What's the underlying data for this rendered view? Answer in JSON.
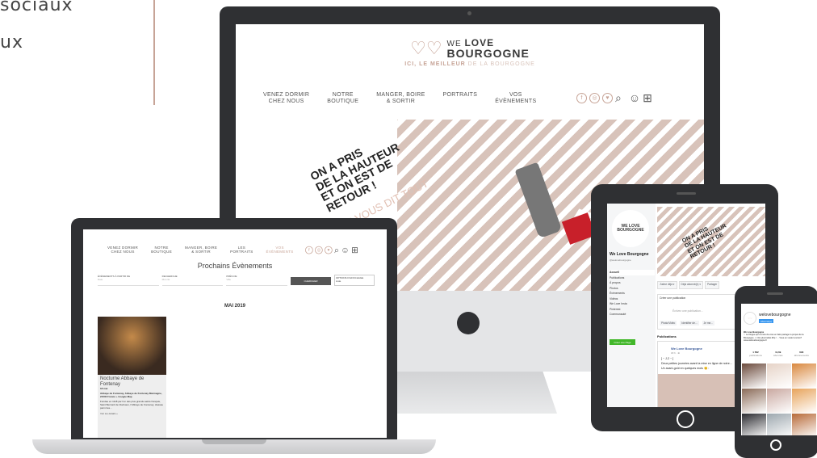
{
  "side_heading": {
    "line1": "sociaux",
    "line2": "ux"
  },
  "brand": {
    "we": "WE",
    "love": "LOVE",
    "bourgogne": "BOURGOGNE",
    "tagline_highlight": "ICI, LE MEILLEUR",
    "tagline_rest": " DE LA BOURGOGNE"
  },
  "desktop_menu": [
    {
      "line1": "VENEZ DORMIR",
      "line2": "CHEZ NOUS"
    },
    {
      "line1": "NOTRE",
      "line2": "BOUTIQUE"
    },
    {
      "line1": "MANGER, BOIRE",
      "line2": "& SORTIR"
    },
    {
      "line1": "PORTRAITS",
      "line2": ""
    },
    {
      "line1": "VOS",
      "line2": "ÉVÈNEMENTS"
    }
  ],
  "laptop_menu": [
    {
      "line1": "VENEZ DORMIR",
      "line2": "CHEZ NOUS"
    },
    {
      "line1": "NOTRE",
      "line2": "BOUTIQUE"
    },
    {
      "line1": "MANGER, BOIRE",
      "line2": "& SORTIR"
    },
    {
      "line1": "LES",
      "line2": "PORTRAITS"
    },
    {
      "line1": "VOS",
      "line2": "ÉVÈNEMENTS"
    }
  ],
  "social_icons": [
    "f",
    "◎",
    "♥"
  ],
  "banner": {
    "line_dark": "ON A PRIS\nDE LA HAUTEUR\nET ON EST DE\nRETOUR !",
    "line_light": "ON VOUS DIT TOUT\nPAR ICI."
  },
  "events_page": {
    "title": "Prochains Évènements",
    "filters": [
      "ÉVÈNEMENTS À PARTIR DE",
      "RECHERCHE",
      "PRÈS DE"
    ],
    "filter_placeholders": [
      "Date",
      "Mot clé",
      "Ville"
    ],
    "search_button": "CHERCHER",
    "options_label": "OPTIONS D'AFFICHAGE",
    "options_value": "Liste",
    "month": "MAI 2019",
    "card": {
      "title": "Nocturne Abbaye de Fontenay",
      "date": "18 mai",
      "address": "Abbaye de Fontenay, Abbaye de Fontenay Marmagne, 21500 France + Google Map",
      "description": "Fondée en 1118 par l'un des plus grands saints français, Saint Bernard de Clairvaux, l'Abbaye de Fontenay, classée parmi les...",
      "more": "Voir les détails »"
    }
  },
  "facebook": {
    "logo_text": "WE LOVE BOURGOGNE",
    "page_name": "We Love Bourgogne",
    "handle": "@welovebourgogne",
    "nav": [
      "Accueil",
      "Publications",
      "À propos",
      "Photos",
      "Évènements",
      "Vidéos",
      "We Love Insta",
      "Pinterest",
      "Communauté"
    ],
    "create_page": "Créer une Page",
    "cover_dark": "ON A PRIS\nDE LA HAUTEUR\nET ON EST DE\nRETOUR !",
    "actions": [
      "J'aime déjà ▾",
      "Déjà abonné(e) ▾",
      "Partager"
    ],
    "create_post": "Créer une publication",
    "write_placeholder": "Écrivez une publication...",
    "post_buttons": [
      "Photo/Vidéo",
      "Identifier de...",
      "Je me..."
    ],
    "publications_label": "Publications",
    "post_author": "We Love Bourgogne",
    "post_date": "18 h · ⊕",
    "post_line1": "[ ~ J-2 ~ ]",
    "post_line2": "Deux petites journées avant la mise en ligne de notre...",
    "post_line3": "Un avant-goût en quelques mots 😊 :"
  },
  "instagram": {
    "username": "welovebourgogne",
    "follow": "Abonné(e)",
    "bio_title": "We Love Bourgogne",
    "bio": "♡ Le blogue qui a envie de vous en faire partager à propos de la Bourgogne. ✦ Vos plus belles #bp ! ... Vous en voulez encore? www.welovebourgogne.fr",
    "stats": [
      {
        "value": "1 562",
        "label": "publications"
      },
      {
        "value": "11,6k",
        "label": "abonnés"
      },
      {
        "value": "693",
        "label": "abonnements"
      }
    ],
    "grid_colors": [
      "#6b4a3c",
      "#e6d3c7",
      "#d9883e",
      "#8a6a57",
      "#c9a8a0",
      "#e7a35a",
      "#2b2b30",
      "#9da7ae",
      "#b76a38",
      "#504238",
      "#c79f7f",
      "#7a5a46"
    ]
  },
  "colors": {
    "brand_rose": "#c7a497",
    "frame": "#2f3033",
    "stripe": "#d8c3ba"
  }
}
